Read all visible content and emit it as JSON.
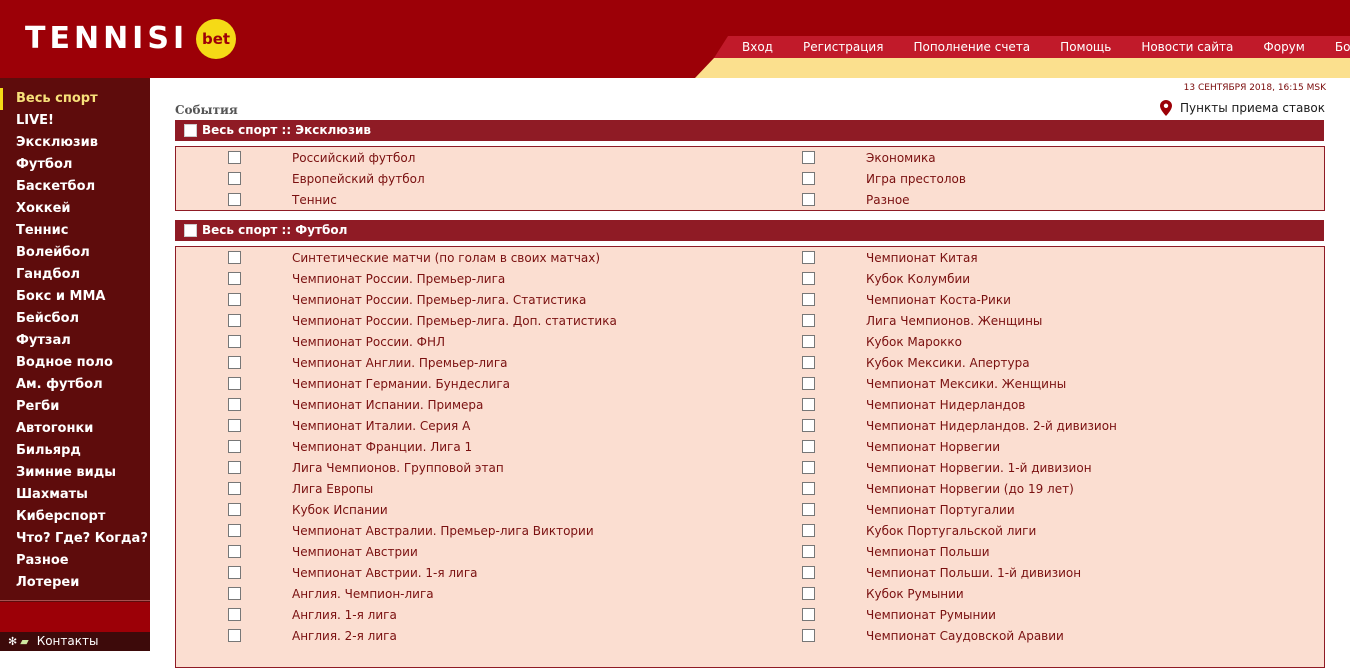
{
  "header": {
    "logo_text": "TENNISI",
    "logo_badge": "bet",
    "colors": {
      "brand": "#9c0007",
      "nav_tab": "#c11a2a",
      "accent": "#f5da16"
    },
    "nav": [
      "Вход",
      "Регистрация",
      "Пополнение счета",
      "Помощь",
      "Новости сайта",
      "Форум",
      "Бонусы"
    ]
  },
  "sidebar": {
    "items": [
      "Весь спорт",
      "LIVE!",
      "Эксклюзив",
      "Футбол",
      "Баскетбол",
      "Хоккей",
      "Теннис",
      "Волейбол",
      "Гандбол",
      "Бокс и ММА",
      "Бейсбол",
      "Футзал",
      "Водное поло",
      "Ам. футбол",
      "Регби",
      "Автогонки",
      "Бильярд",
      "Зимние виды",
      "Шахматы",
      "Киберспорт",
      "Что? Где? Когда?",
      "Разное",
      "Лотереи"
    ],
    "active_index": 0,
    "contacts_label": "Контакты"
  },
  "main": {
    "date": "13 СЕНТЯБРЯ 2018, 16:15 MSK",
    "points_label": "Пункты приема ставок",
    "events_title": "События",
    "sections": [
      {
        "title": "Весь спорт :: Эксклюзив",
        "left": [
          "Российский футбол",
          "Европейский футбол",
          "Теннис"
        ],
        "right": [
          "Экономика",
          "Игра престолов",
          "Разное"
        ]
      },
      {
        "title": "Весь спорт :: Футбол",
        "left": [
          "Синтетические матчи (по голам в своих матчах)",
          "Чемпионат России. Премьер-лига",
          "Чемпионат России. Премьер-лига. Статистика",
          "Чемпионат России. Премьер-лига. Доп. статистика",
          "Чемпионат России. ФНЛ",
          "Чемпионат Англии. Премьер-лига",
          "Чемпионат Германии. Бундеслига",
          "Чемпионат Испании. Примера",
          "Чемпионат Италии. Серия А",
          "Чемпионат Франции. Лига 1",
          "Лига Чемпионов. Групповой этап",
          "Лига Европы",
          "Кубок Испании",
          "Чемпионат Австралии. Премьер-лига Виктории",
          "Чемпионат Австрии",
          "Чемпионат Австрии. 1-я лига",
          "Англия. Чемпион-лига",
          "Англия. 1-я лига",
          "Англия. 2-я лига"
        ],
        "right": [
          "Чемпионат Китая",
          "Кубок Колумбии",
          "Чемпионат Коста-Рики",
          "Лига Чемпионов. Женщины",
          "Кубок Марокко",
          "Кубок Мексики. Апертура",
          "Чемпионат Мексики. Женщины",
          "Чемпионат Нидерландов",
          "Чемпионат Нидерландов. 2-й дивизион",
          "Чемпионат Норвегии",
          "Чемпионат Норвегии. 1-й дивизион",
          "Чемпионат Норвегии (до 19 лет)",
          "Чемпионат Португалии",
          "Кубок Португальской лиги",
          "Чемпионат Польши",
          "Чемпионат Польши. 1-й дивизион",
          "Кубок Румынии",
          "Чемпионат Румынии",
          "Чемпионат Саудовской Аравии"
        ]
      }
    ]
  }
}
